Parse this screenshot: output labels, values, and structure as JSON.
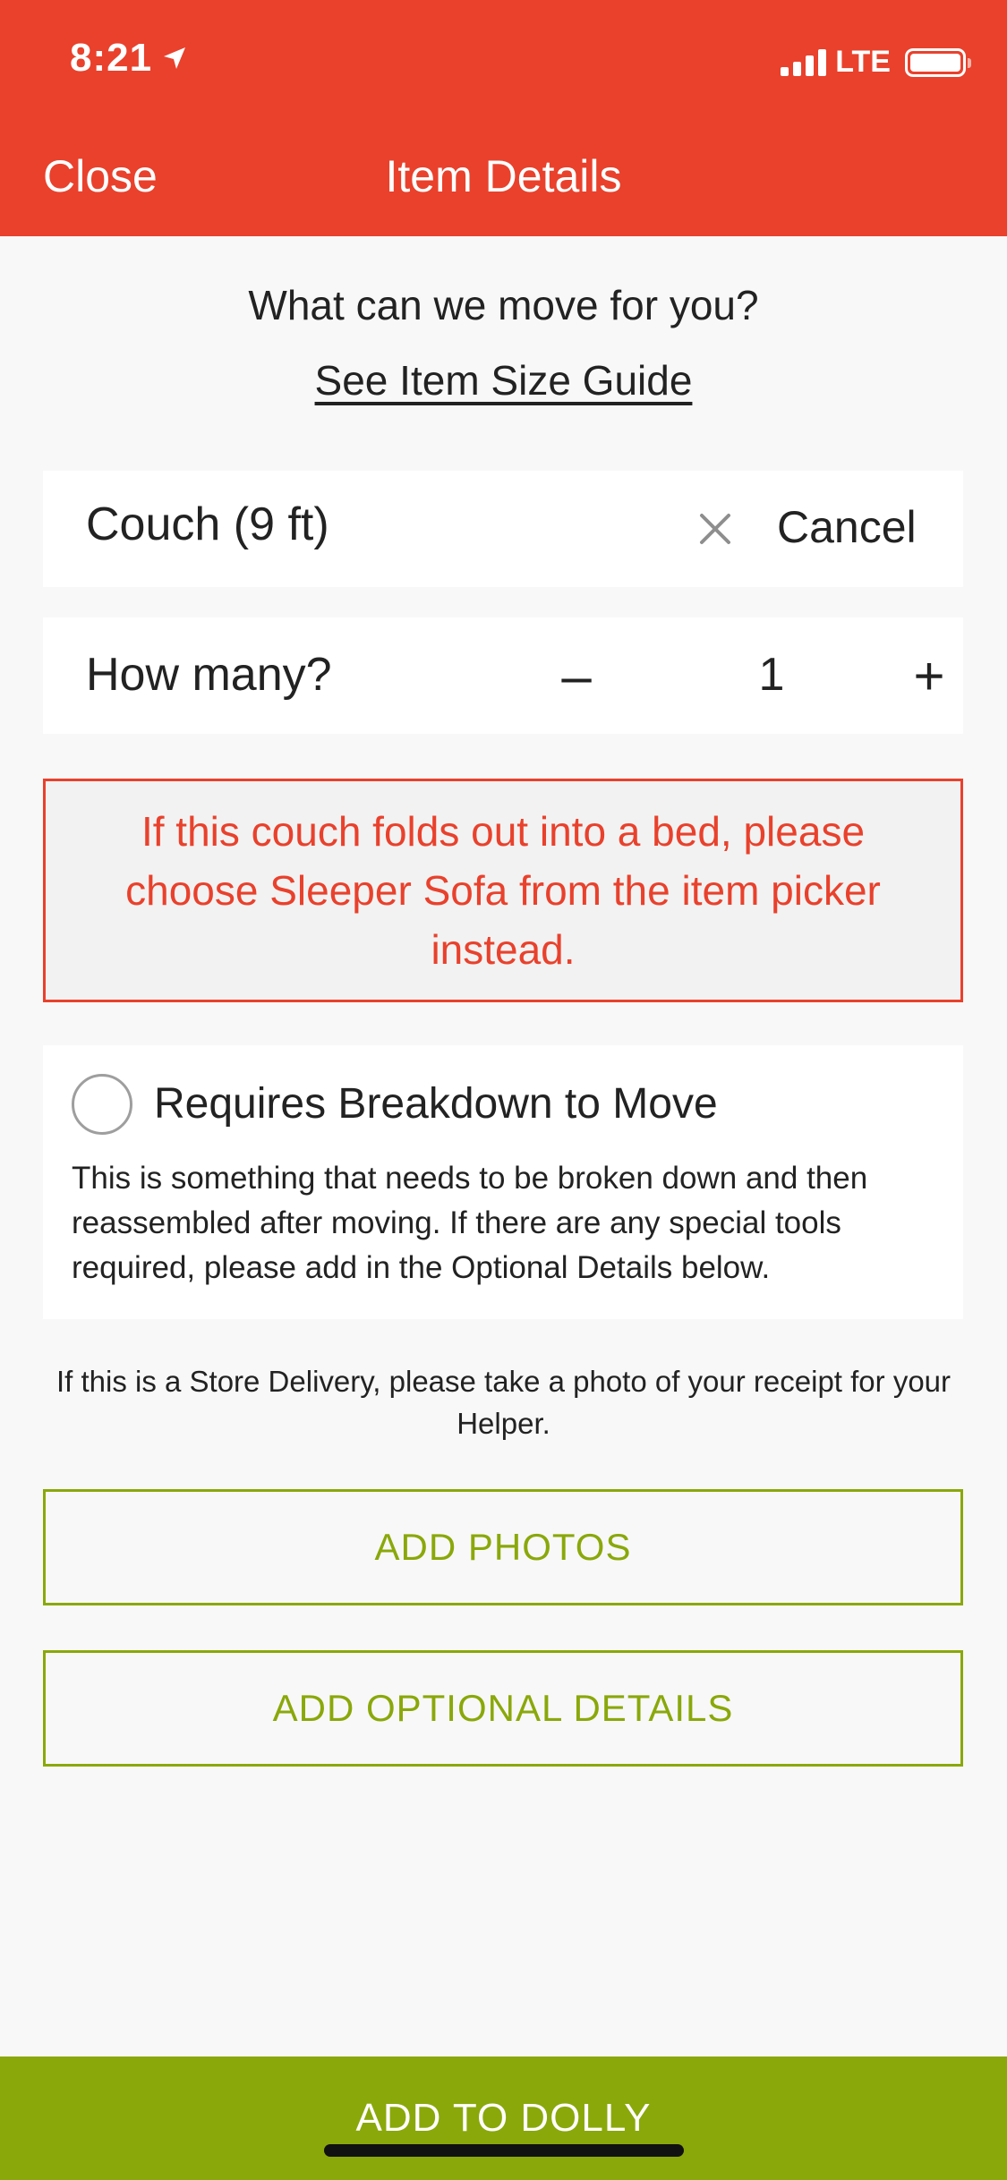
{
  "status_bar": {
    "time": "8:21",
    "carrier": "LTE",
    "icons": [
      "location-arrow-icon",
      "signal-icon",
      "battery-icon"
    ]
  },
  "header": {
    "close_label": "Close",
    "title": "Item Details"
  },
  "main": {
    "question": "What can we move for you?",
    "size_guide_link": "See Item Size Guide",
    "item": {
      "name": "Couch (9 ft)",
      "clear_icon": "close-icon",
      "cancel_label": "Cancel"
    },
    "quantity": {
      "label": "How many?",
      "minus": "–",
      "value": "1",
      "plus": "+"
    },
    "warning": "If this couch folds out into a bed, please choose Sleeper Sofa from the item picker instead.",
    "breakdown": {
      "label": "Requires Breakdown to Move",
      "checked": false,
      "description": "This is something that needs to be broken down and then reassembled after moving. If there are any special tools required, please add in the Optional Details below."
    },
    "store_note": "If this is a Store Delivery, please take a photo of your receipt for your Helper.",
    "add_photos_label": "ADD PHOTOS",
    "add_details_label": "ADD OPTIONAL DETAILS"
  },
  "footer": {
    "add_to_dolly_label": "ADD TO DOLLY"
  },
  "colors": {
    "brand_red": "#e9412c",
    "brand_green": "#8aa80a",
    "background": "#f8f8f8"
  }
}
